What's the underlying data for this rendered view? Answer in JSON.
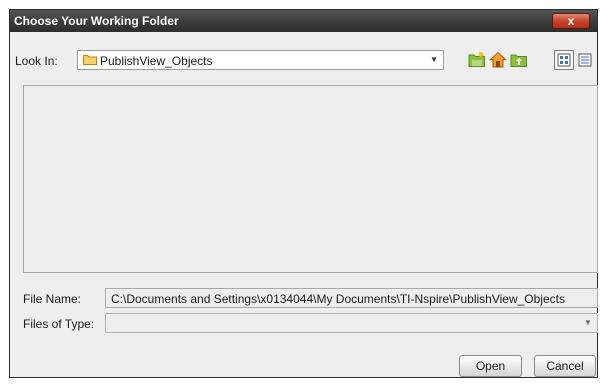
{
  "window": {
    "title": "Choose Your Working Folder",
    "close_label": "x"
  },
  "look_in": {
    "label": "Look In:",
    "value": "PublishView_Objects"
  },
  "toolbar": {
    "icons": [
      "new-folder-icon",
      "home-icon",
      "up-folder-icon",
      "list-view-icon",
      "details-view-icon"
    ]
  },
  "file_name": {
    "label": "File Name:",
    "value": "C:\\Documents and Settings\\x0134044\\My Documents\\TI-Nspire\\PublishView_Objects"
  },
  "files_of_type": {
    "label": "Files of Type:",
    "value": ""
  },
  "buttons": {
    "open": "Open",
    "cancel": "Cancel"
  }
}
